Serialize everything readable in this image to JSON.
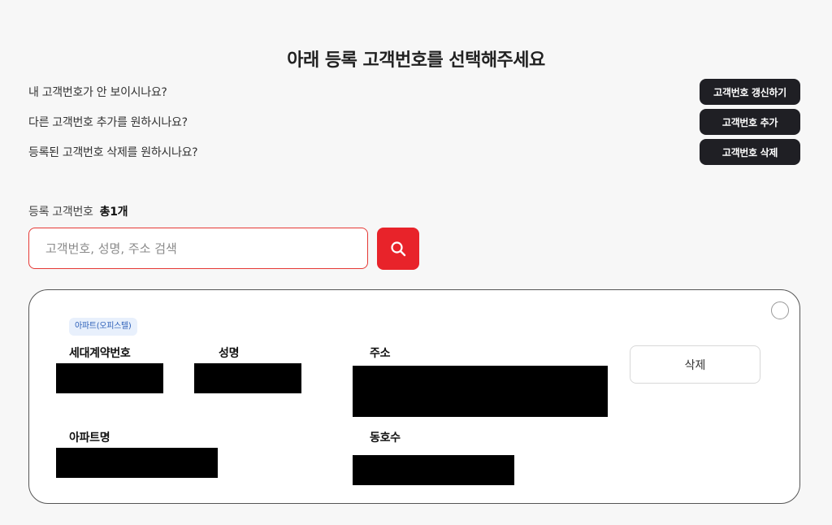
{
  "page": {
    "title": "아래 등록 고객번호를 선택해주세요"
  },
  "questions": [
    {
      "text": "내 고객번호가 안 보이시나요?",
      "button": "고객번호 갱신하기"
    },
    {
      "text": "다른 고객번호 추가를 원하시나요?",
      "button": "고객번호 추가"
    },
    {
      "text": "등록된 고객번호 삭제를 원하시나요?",
      "button": "고객번호 삭제"
    }
  ],
  "list": {
    "label": "등록 고객번호",
    "total": "총1개"
  },
  "search": {
    "placeholder": "고객번호, 성명, 주소 검색",
    "icon": "search-icon"
  },
  "card": {
    "badge": "아파트(오피스텔)",
    "labels": {
      "contract_no": "세대계약번호",
      "name": "성명",
      "address": "주소",
      "apartment": "아파트명",
      "unit": "동호수"
    },
    "delete_label": "삭제",
    "selected": false
  },
  "colors": {
    "accent": "#e8232a",
    "dark_button": "#1f1f24",
    "badge_bg": "#e8f0fc",
    "badge_text": "#2c5fb8"
  }
}
